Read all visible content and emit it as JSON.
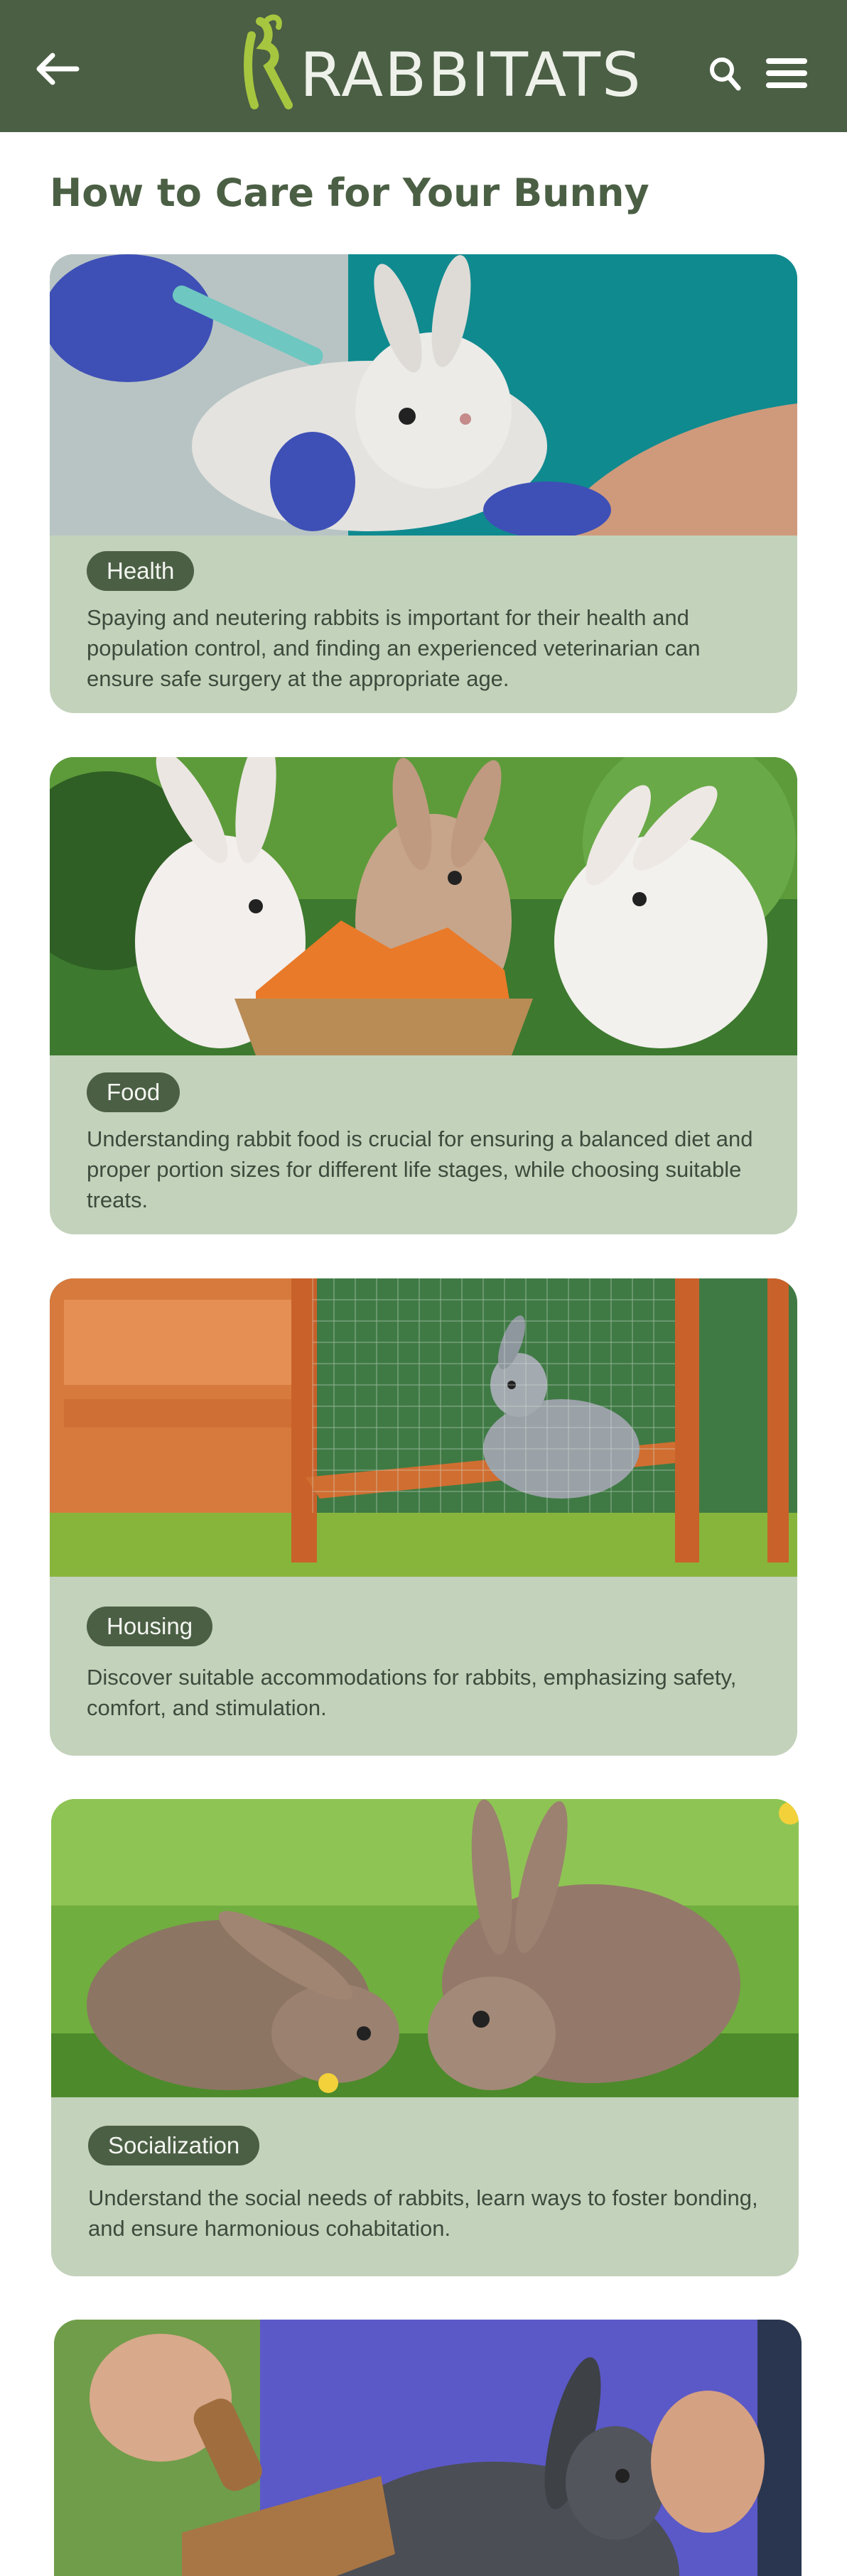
{
  "header": {
    "logo_text": "RABBITATS",
    "back_icon": "arrow-left-icon",
    "search_icon": "search-icon",
    "menu_icon": "hamburger-menu-icon",
    "background_color": "#4b5f45",
    "logo_accent_color": "#a6c640"
  },
  "page": {
    "title": "How to Care for Your Bunny"
  },
  "cards": [
    {
      "tag": "Health",
      "description": "Spaying and neutering rabbits is important for their health and population control, and finding an experienced veterinarian can ensure safe surgery at the appropriate age.",
      "image_alt": "Veterinarian in blue gloves giving an injection to a fluffy grey bunny"
    },
    {
      "tag": "Food",
      "description": "Understanding rabbit food is crucial for ensuring a balanced diet and proper portion sizes for different life stages, while choosing suitable treats.",
      "image_alt": "Four rabbits eating carrots from a wicker basket"
    },
    {
      "tag": "Housing",
      "description": "Discover suitable accommodations for rabbits, emphasizing safety, comfort, and stimulation.",
      "image_alt": "Grey rabbit inside a wooden hutch with wire mesh on grass"
    },
    {
      "tag": "Socialization",
      "description": "Understand the social needs of rabbits, learn ways to foster bonding, and ensure harmonious cohabitation.",
      "image_alt": "Two brown rabbits touching noses in the grass"
    },
    {
      "tag": "",
      "description": "",
      "image_alt": "Person brushing a dark grey rabbit with a grooming brush"
    }
  ],
  "colors": {
    "card_background": "#c3d3bb",
    "badge_background": "#4b5f45",
    "title_color": "#4b5f45"
  }
}
